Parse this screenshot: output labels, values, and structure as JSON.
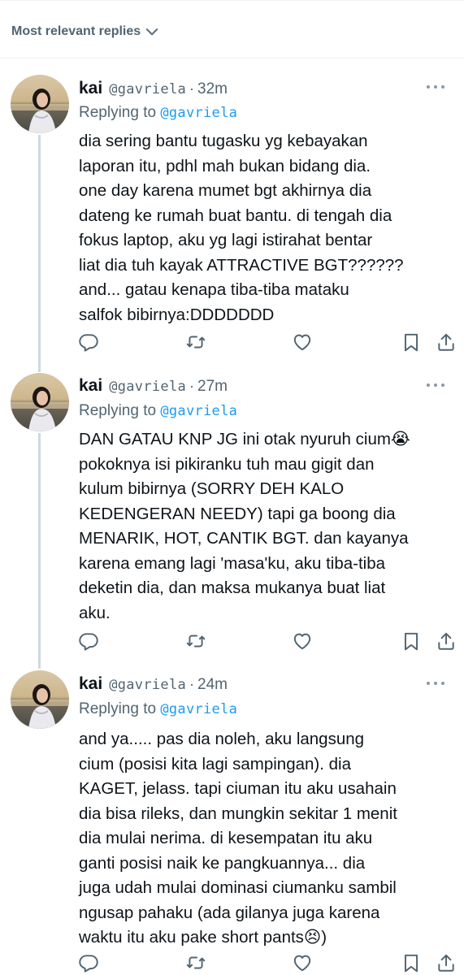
{
  "sort": {
    "label": "Most relevant replies"
  },
  "tweets": [
    {
      "name": "kai",
      "handle": "@gavriela",
      "dot": "·",
      "time": "32m",
      "replying_prefix": "Replying to ",
      "replying_to": "@gavriela",
      "lines": [
        "dia sering bantu tugasku yg kebayakan",
        "laporan itu, pdhl mah bukan bidang dia.",
        "one day karena mumet bgt akhirnya dia",
        "dateng ke rumah buat bantu. di tengah dia",
        "fokus laptop, aku yg lagi istirahat bentar",
        "liat dia tuh kayak ATTRACTIVE BGT??????",
        "and... gatau kenapa tiba-tiba mataku",
        "salfok bibirnya:DDDDDDD"
      ]
    },
    {
      "name": "kai",
      "handle": "@gavriela",
      "dot": "·",
      "time": "27m",
      "replying_prefix": "Replying to ",
      "replying_to": "@gavriela",
      "lines": [
        "DAN GATAU KNP JG ini otak nyuruh cium😭",
        "pokoknya isi pikiranku tuh mau gigit dan",
        "kulum bibirnya (SORRY DEH KALO",
        "KEDENGERAN NEEDY) tapi ga boong dia",
        "MENARIK, HOT, CANTIK BGT. dan kayanya",
        "karena emang lagi 'masa'ku, aku tiba-tiba",
        "deketin dia, dan maksa mukanya buat liat",
        "aku."
      ]
    },
    {
      "name": "kai",
      "handle": "@gavriela",
      "dot": "·",
      "time": "24m",
      "replying_prefix": "Replying to ",
      "replying_to": "@gavriela",
      "lines": [
        "and ya..... pas dia noleh, aku langsung",
        "cium (posisi kita lagi sampingan). dia",
        "KAGET, jelass. tapi ciuman itu aku usahain",
        "dia bisa rileks, dan mungkin sekitar 1 menit",
        "dia mulai nerima. di kesempatan itu aku",
        "ganti posisi naik ke pangkuannya... dia",
        "juga udah mulai dominasi ciumanku sambil",
        "ngusap pahaku (ada gilanya juga karena",
        "waktu itu aku pake short pants😣)"
      ]
    }
  ],
  "icons": {
    "reply": "reply-icon",
    "retweet": "retweet-icon",
    "like": "like-icon",
    "bookmark": "bookmark-icon",
    "share": "share-icon",
    "more": "more-icon",
    "chevron": "chevron-down-icon"
  },
  "colors": {
    "accent": "#1d9bf0",
    "secondary_text": "#536471",
    "primary_text": "#0f1419",
    "thread_line": "#cfd9de"
  }
}
